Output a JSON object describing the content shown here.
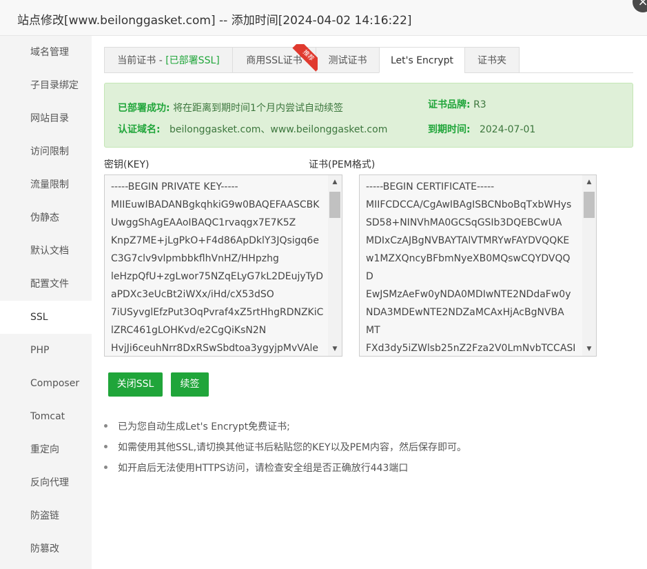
{
  "window": {
    "title": "站点修改[www.beilonggasket.com] -- 添加时间[2024-04-02 14:16:22]",
    "close": "×"
  },
  "sidebar": {
    "items": [
      {
        "label": "域名管理"
      },
      {
        "label": "子目录绑定"
      },
      {
        "label": "网站目录"
      },
      {
        "label": "访问限制"
      },
      {
        "label": "流量限制"
      },
      {
        "label": "伪静态"
      },
      {
        "label": "默认文档"
      },
      {
        "label": "配置文件"
      },
      {
        "label": "SSL",
        "active": true
      },
      {
        "label": "PHP"
      },
      {
        "label": "Composer"
      },
      {
        "label": "Tomcat"
      },
      {
        "label": "重定向"
      },
      {
        "label": "反向代理"
      },
      {
        "label": "防盗链"
      },
      {
        "label": "防篡改"
      }
    ]
  },
  "tabs": {
    "current_prefix": "当前证书 - ",
    "current_status": "[已部署SSL]",
    "commercial": "商用SSL证书",
    "badge": "推荐",
    "test": "测试证书",
    "letsencrypt": "Let's Encrypt",
    "folder": "证书夹"
  },
  "notice": {
    "deployed_key": "已部署成功:",
    "deployed_value": "将在距离到期时间1个月内尝试自动续签",
    "domain_key": "认证域名:",
    "domain_value": "beilonggasket.com、www.beilonggasket.com",
    "brand_key": "证书品牌:",
    "brand_value": "R3",
    "expire_key": "到期时间:",
    "expire_value": "2024-07-01"
  },
  "key_label": "密钥(KEY)",
  "cert_label": "证书(PEM格式)",
  "key_lines": [
    "-----BEGIN PRIVATE KEY-----",
    "MIIEuwIBADANBgkqhkiG9w0BAQEFAASCBK",
    "UwggShAgEAAoIBAQC1rvaqgx7E7K5Z",
    "KnpZ7ME+jLgPkO+F4d86ApDklY3JQsigq6e",
    "C3G7clv9vlpmbbkflhVnHZ/HHpzhg",
    "leHzpQfU+zgLwor75NZqELyG7kL2DEujyTyD",
    "aPDXc3eUcBt2iWXx/iHd/cX53dSO",
    "7iUSyvglEfzPut3OqPvraf4xZ5rtHhgRDNZKiC",
    "lZRC461gLOHKvd/e2CgQiKsN2N",
    "HvjJi6ceuhNrr8DxRSwSbdtoa3ygyjpMvVAle"
  ],
  "cert_lines": [
    "-----BEGIN CERTIFICATE-----",
    "MIIFCDCCA/CgAwIBAgISBCNboBqTxbWHys",
    "SD58+NINVhMA0GCSqGSIb3DQEBCwUA",
    "MDIxCzAJBgNVBAYTAlVTMRYwFAYDVQQKE",
    "w1MZXQncyBFbmNyeXB0MQswCQYDVQQ",
    "D",
    "EwJSMzAeFw0yNDA0MDIwNTE2NDdaFw0y",
    "NDA3MDEwNTE2NDZaMCAxHjAcBgNVBA",
    "MT",
    "FXd3dy5iZWlsb25nZ2Fza2V0LmNvbTCCASI"
  ],
  "buttons": {
    "close_ssl": "关闭SSL",
    "renew": "续签"
  },
  "tips": [
    "已为您自动生成Let's Encrypt免费证书;",
    "如需使用其他SSL,请切换其他证书后粘贴您的KEY以及PEM内容，然后保存即可。",
    "如开启后无法使用HTTPS访问，请检查安全组是否正确放行443端口"
  ],
  "scroll_up": "▲",
  "scroll_down": "▼"
}
